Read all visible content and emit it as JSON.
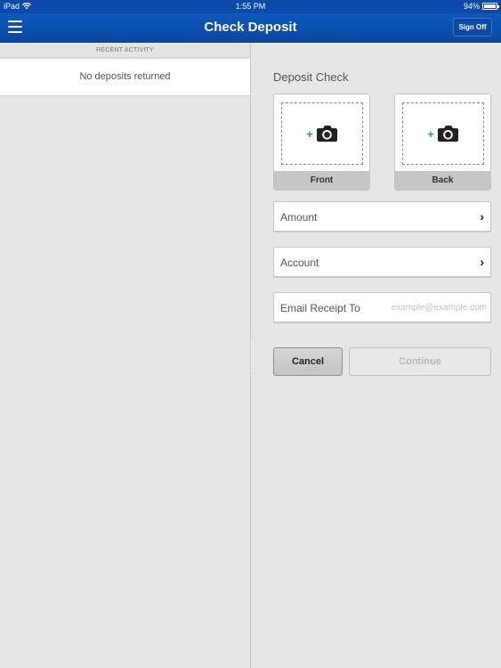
{
  "status_bar": {
    "device": "iPad",
    "time": "1:55 PM",
    "battery": "94%"
  },
  "nav": {
    "title": "Check Deposit",
    "sign_off": "Sign Off"
  },
  "recent_activity": {
    "header": "RECENT ACTIVITY",
    "empty_text": "No deposits returned"
  },
  "deposit": {
    "title": "Deposit Check",
    "front_label": "Front",
    "back_label": "Back",
    "amount_label": "Amount",
    "account_label": "Account",
    "email_label": "Email Receipt To",
    "email_placeholder": "example@example.com",
    "email_value": "",
    "cancel_label": "Cancel",
    "continue_label": "Continue"
  },
  "colors": {
    "nav_blue": "#0a4aa8",
    "plus_blue": "#2a8fd6"
  },
  "icons": [
    "wifi-icon",
    "battery-icon",
    "menu-icon",
    "camera-icon",
    "plus-icon",
    "chevron-right-icon",
    "drag-handle-icon"
  ]
}
